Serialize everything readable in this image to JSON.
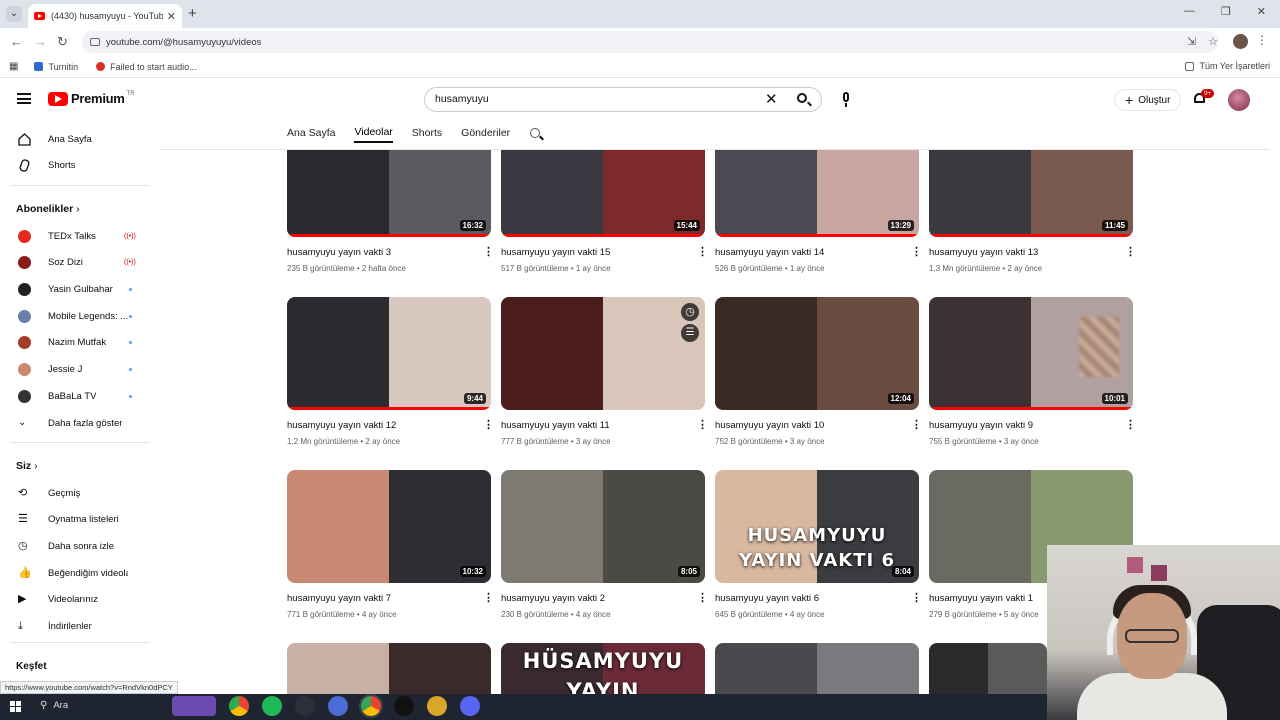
{
  "browser": {
    "tab_title": "(4430) husamyuyu - YouTube",
    "url": "youtube.com/@husamyuyuyu/videos",
    "bookmarks": [
      "Turnitin",
      "Failed to start audio..."
    ],
    "bookmarks_right": "Tüm Yer İşaretleri"
  },
  "header": {
    "logo": "Premium",
    "logo_region": "TR",
    "search_value": "husamyuyu",
    "create_label": "Oluştur",
    "notif_count": "9+"
  },
  "channel_tabs": [
    "Ana Sayfa",
    "Videolar",
    "Shorts",
    "Gönderiler"
  ],
  "active_tab_index": 1,
  "sidebar": {
    "main": [
      "Ana Sayfa",
      "Shorts"
    ],
    "subs_heading": "Abonelikler",
    "subs": [
      {
        "name": "TEDx Talks",
        "status": "live",
        "color": "#e62b1e"
      },
      {
        "name": "Soz Dizi",
        "status": "live",
        "color": "#8b1a1a"
      },
      {
        "name": "Yasin Gulbahar",
        "status": "new",
        "color": "#222222"
      },
      {
        "name": "Mobile Legends: ...",
        "status": "new",
        "color": "#6b7fa8"
      },
      {
        "name": "Nazim Mutfak",
        "status": "new",
        "color": "#a33c2b"
      },
      {
        "name": "Jessie J",
        "status": "new",
        "color": "#c98a6e"
      },
      {
        "name": "BaBaLa TV",
        "status": "new",
        "color": "#333333"
      }
    ],
    "more_label": "Daha fazla göster",
    "you_heading": "Siz",
    "you_items": [
      "Geçmiş",
      "Oynatma listeleri",
      "Daha sonra izle",
      "Beğendiğim videolar",
      "Videolarınız",
      "İndirilenler"
    ],
    "explore_heading": "Keşfet"
  },
  "videos": [
    {
      "title": "husamyuyu yayın vakti 3",
      "meta": "235 B görüntüleme • 2 hafta önce",
      "duration": "16:32",
      "progress": 1.0
    },
    {
      "title": "husamyuyu yayın vakti 15",
      "meta": "517 B görüntüleme • 1 ay önce",
      "duration": "15:44",
      "progress": 1.0
    },
    {
      "title": "husamyuyu yayın vakti 14",
      "meta": "526 B görüntüleme • 1 ay önce",
      "duration": "13:29",
      "progress": 1.0
    },
    {
      "title": "husamyuyu yayın vakti 13",
      "meta": "1,3 Mn görüntüleme • 2 ay önce",
      "duration": "11:45",
      "progress": 1.0
    },
    {
      "title": "husamyuyu yayın vakti 12",
      "meta": "1,2 Mn görüntüleme • 2 ay önce",
      "duration": "9:44",
      "progress": 1.0
    },
    {
      "title": "husamyuyu yayın vakti 11",
      "meta": "777 B görüntüleme • 3 ay önce",
      "duration": "",
      "progress": 0
    },
    {
      "title": "husamyuyu yayın vakti 10",
      "meta": "752 B görüntüleme • 3 ay önce",
      "duration": "12:04",
      "progress": 0
    },
    {
      "title": "husamyuyu yayın vakti 9",
      "meta": "755 B görüntüleme • 3 ay önce",
      "duration": "10:01",
      "progress": 1.0
    },
    {
      "title": "husamyuyu yayın vakti 7",
      "meta": "771 B görüntüleme • 4 ay önce",
      "duration": "10:32",
      "progress": 0
    },
    {
      "title": "husamyuyu yayın vakti 2",
      "meta": "230 B görüntüleme • 4 ay önce",
      "duration": "8:05",
      "progress": 0
    },
    {
      "title": "husamyuyu yayın vakti 6",
      "meta": "645 B görüntüleme • 4 ay önce",
      "duration": "8:04",
      "progress": 0
    },
    {
      "title": "husamyuyu yayın vakti 1",
      "meta": "279 B görüntüleme • 5 ay önce",
      "duration": "",
      "progress": 0
    }
  ],
  "thumb_overlays": {
    "v11": [
      "HUSAMYUYU",
      "YAYIN VAKTI 6"
    ],
    "row4": [
      "HÜSAMYUYU",
      "YAYIN"
    ]
  },
  "status_url": "https://www.youtube.com/watch?v=RndVkn0dPCY",
  "taskbar": {
    "search": "Ara"
  }
}
